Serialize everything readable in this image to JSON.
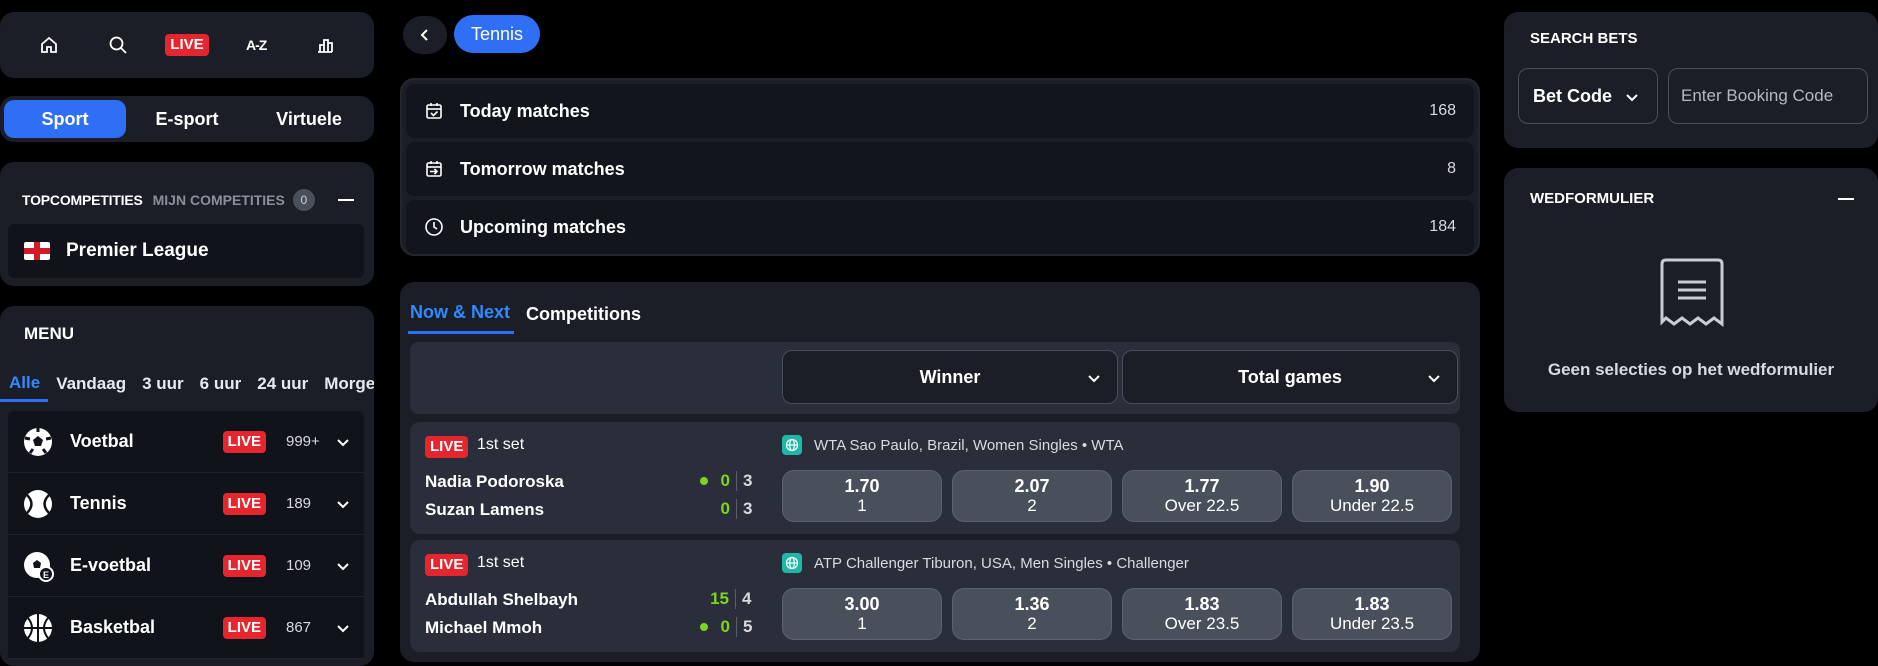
{
  "topnav": {
    "live_label": "LIVE",
    "az_label": "A-Z",
    "icons": [
      "home-icon",
      "search-icon",
      "live",
      "az",
      "stats-icon"
    ]
  },
  "sport_tabs": [
    "Sport",
    "E-sport",
    "Virtuele"
  ],
  "top_competitions": {
    "title": "TOPCOMPETITIES",
    "mine_label": "MIJN COMPETITIES",
    "mine_count": "0",
    "items": [
      {
        "label": "Premier League",
        "flag": "england"
      }
    ]
  },
  "menu": {
    "title": "MENU",
    "time_tabs": [
      "Alle",
      "Vandaag",
      "3 uur",
      "6 uur",
      "24 uur",
      "Morgen"
    ],
    "sports": [
      {
        "name": "Voetbal",
        "live": "LIVE",
        "count": "999+",
        "icon": "soccer-ball-icon"
      },
      {
        "name": "Tennis",
        "live": "LIVE",
        "count": "189",
        "icon": "tennis-ball-icon"
      },
      {
        "name": "E-voetbal",
        "live": "LIVE",
        "count": "109",
        "icon": "esoccer-icon"
      },
      {
        "name": "Basketbal",
        "live": "LIVE",
        "count": "867",
        "icon": "basketball-icon"
      }
    ]
  },
  "breadcrumb": {
    "current": "Tennis"
  },
  "quick_links": [
    {
      "label": "Today matches",
      "count": "168",
      "icon": "calendar-check-icon"
    },
    {
      "label": "Tomorrow matches",
      "count": "8",
      "icon": "calendar-arrow-icon"
    },
    {
      "label": "Upcoming matches",
      "count": "184",
      "icon": "clock-icon"
    }
  ],
  "match_tabs": [
    "Now & Next",
    "Competitions"
  ],
  "market_filters": {
    "winner": "Winner",
    "total_games": "Total games"
  },
  "matches": [
    {
      "live": "LIVE",
      "period": "1st set",
      "competition": "WTA Sao Paulo, Brazil, Women Singles • WTA",
      "player1": "Nadia Podoroska",
      "player2": "Suzan Lamens",
      "p1_points": "0",
      "p1_games": "3",
      "p2_points": "0",
      "p2_games": "3",
      "odds": [
        {
          "value": "1.70",
          "label": "1"
        },
        {
          "value": "2.07",
          "label": "2"
        },
        {
          "value": "1.77",
          "label": "Over 22.5"
        },
        {
          "value": "1.90",
          "label": "Under 22.5"
        }
      ]
    },
    {
      "live": "LIVE",
      "period": "1st set",
      "competition": "ATP Challenger Tiburon, USA, Men Singles • Challenger",
      "player1": "Abdullah Shelbayh",
      "player2": "Michael Mmoh",
      "p1_points": "15",
      "p1_games": "4",
      "p2_points": "0",
      "p2_games": "5",
      "odds": [
        {
          "value": "3.00",
          "label": "1"
        },
        {
          "value": "1.36",
          "label": "2"
        },
        {
          "value": "1.83",
          "label": "Over 23.5"
        },
        {
          "value": "1.83",
          "label": "Under 23.5"
        }
      ]
    }
  ],
  "search_bets": {
    "title": "SEARCH BETS",
    "code_type": "Bet Code",
    "placeholder": "Enter Booking Code"
  },
  "betslip": {
    "title": "WEDFORMULIER",
    "empty_message": "Geen selecties op het wedformulier"
  },
  "colors": {
    "accent": "#2f6ff5",
    "live": "#e6262f",
    "panel": "#1b1e27",
    "serve_dot": "#7fd321"
  }
}
